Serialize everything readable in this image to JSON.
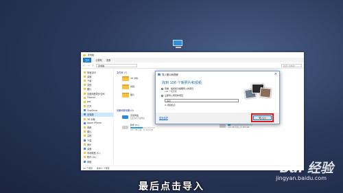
{
  "explorer": {
    "title": "此电脑",
    "ribbon": [
      "文件",
      "计算机",
      "查看"
    ],
    "address": "此电脑",
    "search_placeholder": "搜索\"此电脑\"",
    "sidebar": [
      {
        "label": "快速访问"
      },
      {
        "label": "桌面"
      },
      {
        "label": "下载"
      },
      {
        "label": "文档"
      },
      {
        "label": "图片"
      },
      {
        "label": "百度网盘同步空间"
      },
      {
        "label": "Tutorial"
      },
      {
        "label": "ppt"
      },
      {
        "label": "打开"
      },
      {
        "label": "OneDrive"
      },
      {
        "label": "此电脑"
      },
      {
        "label": "3D 对象"
      },
      {
        "label": "Apple iPhone"
      },
      {
        "label": "视频"
      },
      {
        "label": "图片"
      },
      {
        "label": "文档"
      },
      {
        "label": "下载"
      },
      {
        "label": "音乐"
      },
      {
        "label": "桌面"
      },
      {
        "label": "本地磁盘 (C:)"
      },
      {
        "label": "软件 (D:)"
      },
      {
        "label": "网络"
      }
    ],
    "sections": {
      "folders": "文件夹 (7)",
      "devices": "设备和驱动器 (4)"
    },
    "folders": [
      {
        "label": "3D 对象"
      },
      {
        "label": "视频"
      },
      {
        "label": "图片"
      }
    ],
    "devices": [
      {
        "label": "百度网盘",
        "sub": "双击运行百度网盘",
        "usage": 0
      },
      {
        "label": "软件 (D:)",
        "sub": "45.7 GB 可用，共 92.9 GB",
        "usage": 0.51
      }
    ],
    "right_drives": [
      {
        "label": "",
        "sub": "共 215 GB",
        "usage": 0.4
      },
      {
        "label": "",
        "sub": "415 GB 可用，共 465 GB",
        "usage": 0.11
      }
    ],
    "status": {
      "count": "12 个项目",
      "selected": "选中 1 个项目"
    }
  },
  "dialog": {
    "title": "导入照片和视频",
    "heading": "找到 106 个新照片和视频",
    "option1": "查看、组织和分组要导入的项目",
    "option1_note": "106 个项目组",
    "option2": "立即导入所有新项目",
    "input_value": "演示",
    "more_options": "添加标记",
    "link": "更多选项",
    "import_label": "导入(I)"
  },
  "caption": "最后点击导入",
  "watermark": {
    "logo": "Bai 经验",
    "url": "jingyan.baidu.com"
  }
}
